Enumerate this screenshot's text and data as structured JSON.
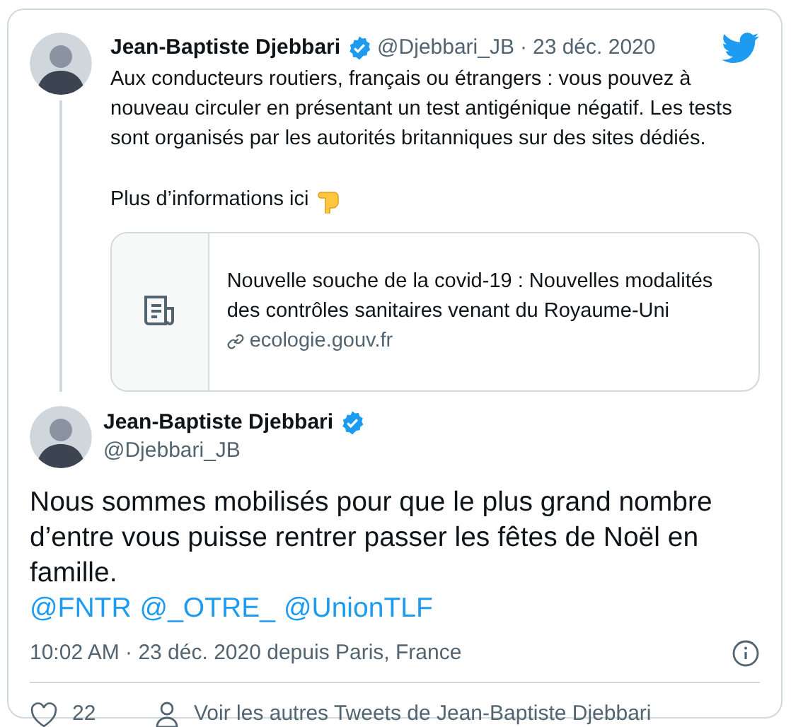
{
  "quoted_tweet": {
    "author": {
      "name": "Jean-Baptiste Djebbari",
      "verified": true,
      "handle": "@Djebbari_JB"
    },
    "separator": "·",
    "date": "23 déc. 2020",
    "paragraphs": [
      "Aux conducteurs routiers, français ou étrangers : vous pouvez à nouveau circuler en présentant un test antigénique négatif. Les tests sont organisés par les autorités britanniques sur des sites dédiés.",
      "Plus d’informations ici"
    ],
    "link_card": {
      "title": "Nouvelle souche de la covid-19 : Nouvelles modalités des contrôles sanitaires venant du Royaume-Uni",
      "domain": "ecologie.gouv.fr"
    }
  },
  "tweet": {
    "author": {
      "name": "Jean-Baptiste Djebbari",
      "verified": true,
      "handle": "@Djebbari_JB"
    },
    "text": "Nous sommes mobilisés pour que le plus grand nombre d’entre vous puisse rentrer passer les fêtes de Noël en famille.",
    "mentions": [
      "@FNTR",
      "@_OTRE_",
      "@UnionTLF"
    ],
    "timestamp": "10:02 AM · 23 déc. 2020 depuis Paris, France"
  },
  "footer": {
    "likes": "22",
    "more_tweets": "Voir les autres Tweets de Jean-Baptiste Djebbari"
  }
}
